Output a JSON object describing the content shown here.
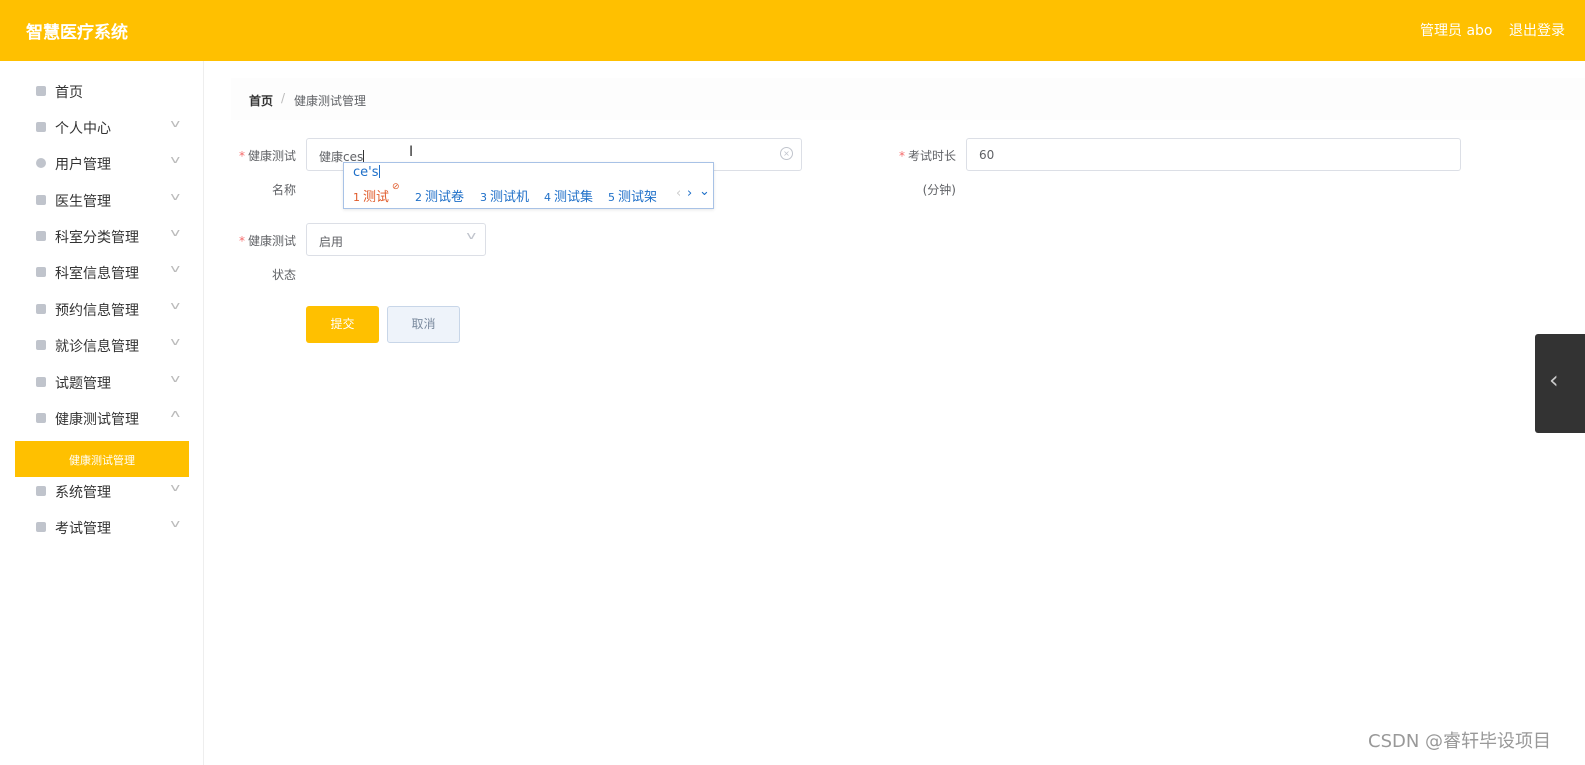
{
  "header": {
    "brand": "智慧医疗系统",
    "user_label": "管理员 abo",
    "logout_label": "退出登录",
    "accent_color": "#ffc000"
  },
  "sidebar": {
    "items": [
      {
        "label": "首页",
        "icon": "home-icon",
        "expandable": false
      },
      {
        "label": "个人中心",
        "icon": "user-icon",
        "expandable": true
      },
      {
        "label": "用户管理",
        "icon": "location-pin-icon",
        "expandable": true
      },
      {
        "label": "医生管理",
        "icon": "grid-icon",
        "expandable": true
      },
      {
        "label": "科室分类管理",
        "icon": "clipboard-icon",
        "expandable": true
      },
      {
        "label": "科室信息管理",
        "icon": "list-icon",
        "expandable": true
      },
      {
        "label": "预约信息管理",
        "icon": "cup-icon",
        "expandable": true
      },
      {
        "label": "就诊信息管理",
        "icon": "briefcase-icon",
        "expandable": true
      },
      {
        "label": "试题管理",
        "icon": "document-icon",
        "expandable": true
      },
      {
        "label": "健康测试管理",
        "icon": "bar-chart-icon",
        "expandable": true,
        "expanded": true
      },
      {
        "label": "系统管理",
        "icon": "grid-icon",
        "expandable": true
      },
      {
        "label": "考试管理",
        "icon": "apps-icon",
        "expandable": true
      }
    ],
    "active_subitem": "健康测试管理"
  },
  "breadcrumb": {
    "home": "首页",
    "separator": "/",
    "current": "健康测试管理"
  },
  "form": {
    "name_label_line1": "健康测试",
    "name_label_line2": "名称",
    "name_value": "健康ces",
    "duration_label_line1": "考试时长",
    "duration_label_line2": "(分钟)",
    "duration_value": "60",
    "status_label_line1": "健康测试",
    "status_label_line2": "状态",
    "status_value": "启用",
    "required_mark": "*",
    "submit_label": "提交",
    "cancel_label": "取消"
  },
  "ime": {
    "composition": "ce's",
    "candidates": [
      {
        "num": "1",
        "text": "测试"
      },
      {
        "num": "2",
        "text": "测试卷"
      },
      {
        "num": "3",
        "text": "测试机"
      },
      {
        "num": "4",
        "text": "测试集"
      },
      {
        "num": "5",
        "text": "测试架"
      }
    ],
    "prev": "‹",
    "next": "›",
    "expand": "⌄"
  },
  "watermark": "CSDN @睿轩毕设项目"
}
